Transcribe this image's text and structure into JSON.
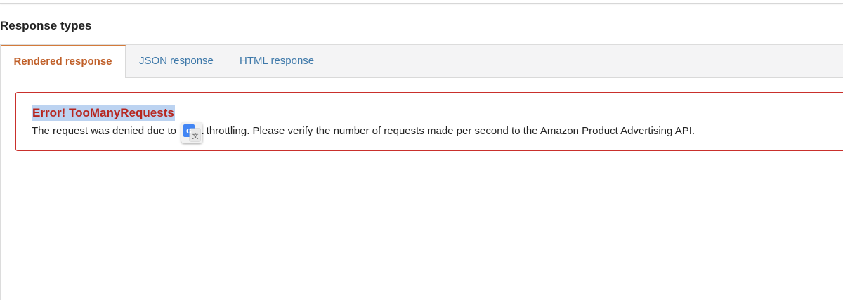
{
  "section": {
    "title": "Response types"
  },
  "tabs": [
    {
      "label": "Rendered response",
      "active": true
    },
    {
      "label": "JSON response",
      "active": false
    },
    {
      "label": "HTML response",
      "active": false
    }
  ],
  "alert": {
    "title": "Error! TooManyRequests",
    "message_before": "The request was denied due to ",
    "message_after": "uest throttling. Please verify the number of requests made per second to the Amazon Product Advertising API."
  },
  "colors": {
    "active_tab": "#c0602a",
    "tab_link": "#3d78a9",
    "error_border": "#c9302c",
    "error_title": "#b7261f",
    "selection_highlight": "#bcd3f1"
  },
  "icons": {
    "translate": "google-translate-icon"
  }
}
